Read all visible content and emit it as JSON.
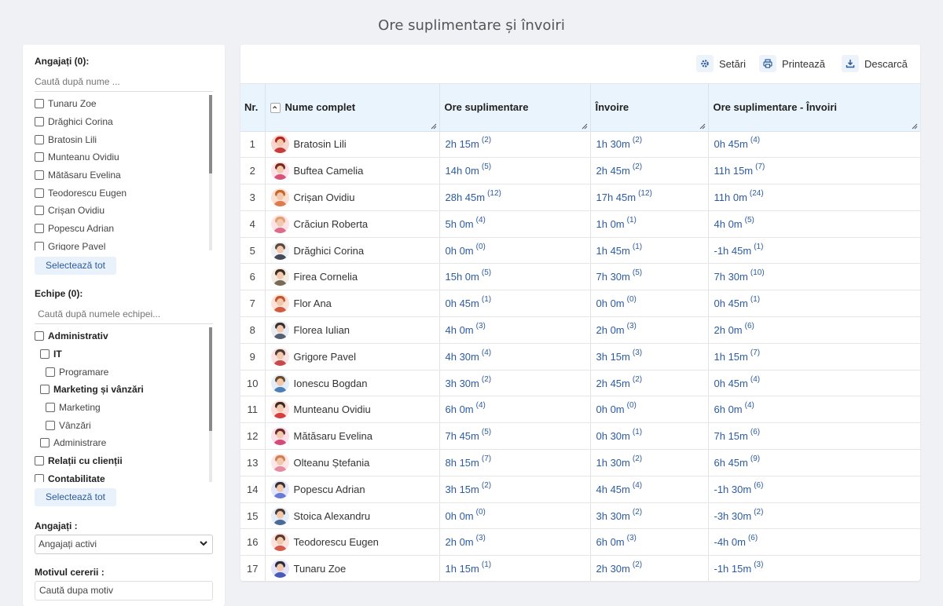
{
  "page_title": "Ore suplimentare și învoiri",
  "left": {
    "employees_label": "Angajați (0):",
    "employees_search_placeholder": "Caută după nume ...",
    "employees": [
      "Tunaru Zoe",
      "Drăghici Corina",
      "Bratosin Lili",
      "Munteanu Ovidiu",
      "Mătăsaru Evelina",
      "Teodorescu Eugen",
      "Crișan Ovidiu",
      "Popescu Adrian",
      "Grigore Pavel"
    ],
    "select_all_label": "Selectează tot",
    "teams_label": "Echipe (0):",
    "teams_search_placeholder": "Caută după numele echipei...",
    "teams": [
      {
        "label": "Administrativ",
        "bold": true,
        "indent": 0
      },
      {
        "label": "IT",
        "bold": true,
        "indent": 1
      },
      {
        "label": "Programare",
        "bold": false,
        "indent": 2
      },
      {
        "label": "Marketing și vânzări",
        "bold": true,
        "indent": 1
      },
      {
        "label": "Marketing",
        "bold": false,
        "indent": 2
      },
      {
        "label": "Vânzări",
        "bold": false,
        "indent": 2
      },
      {
        "label": "Administrare",
        "bold": false,
        "indent": 1
      },
      {
        "label": "Relații cu clienții",
        "bold": true,
        "indent": 0
      },
      {
        "label": "Contabilitate",
        "bold": true,
        "indent": 0
      }
    ],
    "status_label": "Angajați :",
    "status_value": "Angajați activi",
    "reason_label": "Motivul cererii :",
    "reason_placeholder": "Caută dupa motiv"
  },
  "toolbar": {
    "settings_label": "Setări",
    "print_label": "Printează",
    "download_label": "Descarcă"
  },
  "table": {
    "headers": {
      "nr": "Nr.",
      "name": "Nume complet",
      "overtime": "Ore suplimentare",
      "leave": "Învoire",
      "diff": "Ore suplimentare - Învoiri"
    },
    "rows": [
      {
        "nr": "1",
        "name": "Bratosin Lili",
        "ot": "2h 15m",
        "ot_c": "(2)",
        "lv": "1h 30m",
        "lv_c": "(2)",
        "df": "0h 45m",
        "df_c": "(4)"
      },
      {
        "nr": "2",
        "name": "Buftea Camelia",
        "ot": "14h 0m",
        "ot_c": "(5)",
        "lv": "2h 45m",
        "lv_c": "(2)",
        "df": "11h 15m",
        "df_c": "(7)"
      },
      {
        "nr": "3",
        "name": "Crișan Ovidiu",
        "ot": "28h 45m",
        "ot_c": "(12)",
        "lv": "17h 45m",
        "lv_c": "(12)",
        "df": "11h 0m",
        "df_c": "(24)"
      },
      {
        "nr": "4",
        "name": "Crăciun Roberta",
        "ot": "5h 0m",
        "ot_c": "(4)",
        "lv": "1h 0m",
        "lv_c": "(1)",
        "df": "4h 0m",
        "df_c": "(5)"
      },
      {
        "nr": "5",
        "name": "Drăghici Corina",
        "ot": "0h 0m",
        "ot_c": "(0)",
        "lv": "1h 45m",
        "lv_c": "(1)",
        "df": "-1h 45m",
        "df_c": "(1)"
      },
      {
        "nr": "6",
        "name": "Firea Cornelia",
        "ot": "15h 0m",
        "ot_c": "(5)",
        "lv": "7h 30m",
        "lv_c": "(5)",
        "df": "7h 30m",
        "df_c": "(10)"
      },
      {
        "nr": "7",
        "name": "Flor Ana",
        "ot": "0h 45m",
        "ot_c": "(1)",
        "lv": "0h 0m",
        "lv_c": "(0)",
        "df": "0h 45m",
        "df_c": "(1)"
      },
      {
        "nr": "8",
        "name": "Florea Iulian",
        "ot": "4h 0m",
        "ot_c": "(3)",
        "lv": "2h 0m",
        "lv_c": "(3)",
        "df": "2h 0m",
        "df_c": "(6)"
      },
      {
        "nr": "9",
        "name": "Grigore Pavel",
        "ot": "4h 30m",
        "ot_c": "(4)",
        "lv": "3h 15m",
        "lv_c": "(3)",
        "df": "1h 15m",
        "df_c": "(7)"
      },
      {
        "nr": "10",
        "name": "Ionescu Bogdan",
        "ot": "3h 30m",
        "ot_c": "(2)",
        "lv": "2h 45m",
        "lv_c": "(2)",
        "df": "0h 45m",
        "df_c": "(4)"
      },
      {
        "nr": "11",
        "name": "Munteanu Ovidiu",
        "ot": "6h 0m",
        "ot_c": "(4)",
        "lv": "0h 0m",
        "lv_c": "(0)",
        "df": "6h 0m",
        "df_c": "(4)"
      },
      {
        "nr": "12",
        "name": "Mătăsaru Evelina",
        "ot": "7h 45m",
        "ot_c": "(5)",
        "lv": "0h 30m",
        "lv_c": "(1)",
        "df": "7h 15m",
        "df_c": "(6)"
      },
      {
        "nr": "13",
        "name": "Olteanu Ștefania",
        "ot": "8h 15m",
        "ot_c": "(7)",
        "lv": "1h 30m",
        "lv_c": "(2)",
        "df": "6h 45m",
        "df_c": "(9)"
      },
      {
        "nr": "14",
        "name": "Popescu Adrian",
        "ot": "3h 15m",
        "ot_c": "(2)",
        "lv": "4h 45m",
        "lv_c": "(4)",
        "df": "-1h 30m",
        "df_c": "(6)"
      },
      {
        "nr": "15",
        "name": "Stoica Alexandru",
        "ot": "0h 0m",
        "ot_c": "(0)",
        "lv": "3h 30m",
        "lv_c": "(2)",
        "df": "-3h 30m",
        "df_c": "(2)"
      },
      {
        "nr": "16",
        "name": "Teodorescu Eugen",
        "ot": "2h 0m",
        "ot_c": "(3)",
        "lv": "6h 0m",
        "lv_c": "(3)",
        "df": "-4h 0m",
        "df_c": "(6)"
      },
      {
        "nr": "17",
        "name": "Tunaru Zoe",
        "ot": "1h 15m",
        "ot_c": "(1)",
        "lv": "2h 30m",
        "lv_c": "(2)",
        "df": "-1h 15m",
        "df_c": "(3)"
      }
    ]
  },
  "colors": {
    "accent": "#2c5ba0",
    "header_bg": "#eaf4fd",
    "page_bg": "#eff1f5"
  },
  "avatars": [
    {
      "bg": "#f7d6cf",
      "hair": "#b3261e",
      "body": "#c93a3a"
    },
    {
      "bg": "#fde2e8",
      "hair": "#7a2a1a",
      "body": "#d8527a"
    },
    {
      "bg": "#fce1d2",
      "hair": "#c5652a",
      "body": "#e07a4d"
    },
    {
      "bg": "#fde2e8",
      "hair": "#e0a070",
      "body": "#e06a8a"
    },
    {
      "bg": "#eef0f4",
      "hair": "#5a4a3e",
      "body": "#444a57"
    },
    {
      "bg": "#f2ece4",
      "hair": "#3a2a20",
      "body": "#7a6a55"
    },
    {
      "bg": "#fde2d8",
      "hair": "#c5552a",
      "body": "#d05c40"
    },
    {
      "bg": "#e9edf3",
      "hair": "#3a3030",
      "body": "#556070"
    },
    {
      "bg": "#fbe3e3",
      "hair": "#4a3a30",
      "body": "#c94a4a"
    },
    {
      "bg": "#e4eefa",
      "hair": "#6a4a2a",
      "body": "#4a80b8"
    },
    {
      "bg": "#fde0dc",
      "hair": "#3a2a20",
      "body": "#d93e3e"
    },
    {
      "bg": "#fce0ea",
      "hair": "#6a2a2a",
      "body": "#d64a7a"
    },
    {
      "bg": "#fde6e8",
      "hair": "#d08050",
      "body": "#e58aa0"
    },
    {
      "bg": "#e4e6fa",
      "hair": "#3a3030",
      "body": "#6a7ad8"
    },
    {
      "bg": "#e6eef8",
      "hair": "#4a3a30",
      "body": "#4a6a9a"
    },
    {
      "bg": "#fde1dc",
      "hair": "#5a3a2a",
      "body": "#d55a4a"
    },
    {
      "bg": "#e4e4fa",
      "hair": "#2a2a3a",
      "body": "#4a5ab8"
    }
  ]
}
